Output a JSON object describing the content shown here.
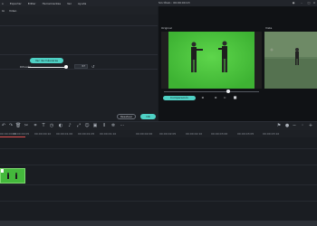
{
  "menubar": {
    "items": [
      "o",
      "Exportar",
      "Editar",
      "Herramientas",
      "Ver",
      "Ayuda"
    ],
    "preview_title": "Sin título : 00:00:00:13"
  },
  "left_panel": {
    "tabs": [
      "IA",
      "Video",
      "Animacion"
    ],
    "mask_button": "Ver de máscaras",
    "blur_label": "Difusión",
    "blur_value": "37",
    "blur_level": 1.0,
    "reset_label": "Resetear",
    "ok_label": "OK"
  },
  "preview": {
    "before_label": "Original",
    "after_label": "Vista",
    "compare_label": "Comparación",
    "scrub_position": 0.68
  },
  "timeline": {
    "ticks": [
      "00:00:00:00",
      "00:00:00:05",
      "00:00:00:10",
      "00:00:01:00",
      "00:00:01:05",
      "00:00:01:10",
      "00:00:02:00",
      "00:00:02:05",
      "00:00:02:10",
      "00:00:03:00",
      "00:00:03:05",
      "00:00:03:10"
    ]
  },
  "colors": {
    "accent": "#4fd1c5",
    "green_screen": "#4ccb3c",
    "playhead": "#e25050"
  }
}
